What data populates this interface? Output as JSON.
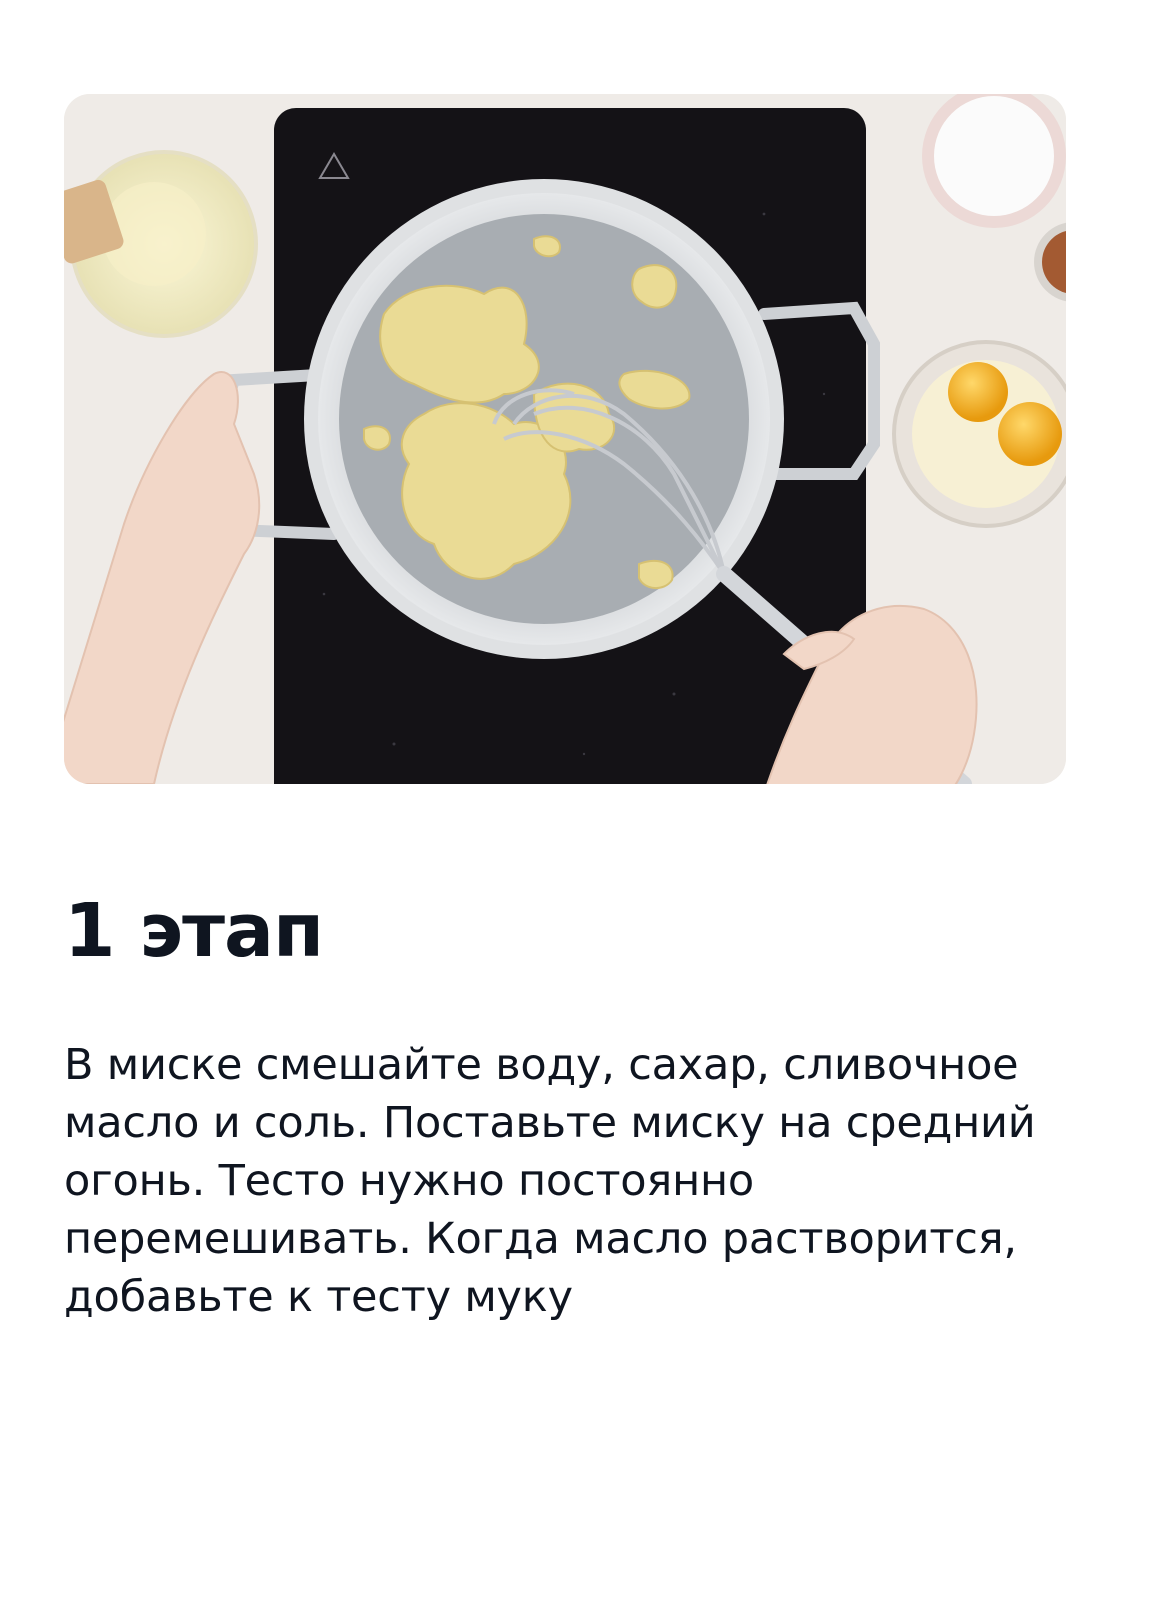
{
  "step": {
    "title": "1 этап",
    "description": "В миске смешайте воду, сахар, сливочное масло и соль. Поставьте миску на средний огонь. Тесто нужно постоянно перемешивать. Когда масло растворится, добавьте к тесту муку"
  },
  "photo": {
    "subject": "pan-with-dough-on-induction-stove",
    "colors": {
      "table": "#eeeae6",
      "stove": "#141216",
      "pan": "#b9bcc0",
      "dough": "#eadb95",
      "yolk": "#f2b21f"
    }
  }
}
